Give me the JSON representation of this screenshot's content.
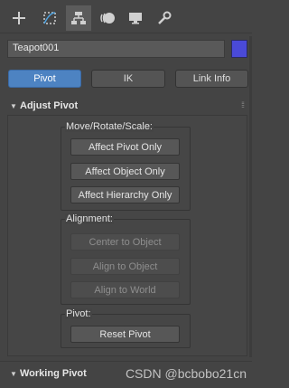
{
  "toolbar": {
    "tools": [
      "create-icon",
      "modify-icon",
      "hierarchy-icon",
      "motion-icon",
      "display-icon",
      "utilities-icon"
    ],
    "active_tool": "hierarchy-icon"
  },
  "object": {
    "name": "Teapot001",
    "color": "#4a4ad8"
  },
  "tabs": [
    {
      "label": "Pivot",
      "active": true
    },
    {
      "label": "IK",
      "active": false
    },
    {
      "label": "Link Info",
      "active": false
    }
  ],
  "adjust_pivot": {
    "title": "Adjust Pivot",
    "move_group": {
      "label": "Move/Rotate/Scale:",
      "buttons": [
        "Affect Pivot Only",
        "Affect Object Only",
        "Affect Hierarchy Only"
      ]
    },
    "alignment_group": {
      "label": "Alignment:",
      "buttons": [
        "Center to Object",
        "Align to Object",
        "Align to World"
      ]
    },
    "pivot_group": {
      "label": "Pivot:",
      "buttons": [
        "Reset Pivot"
      ]
    }
  },
  "working_pivot": {
    "title": "Working Pivot"
  },
  "watermark": "CSDN @bcbobo21cn"
}
